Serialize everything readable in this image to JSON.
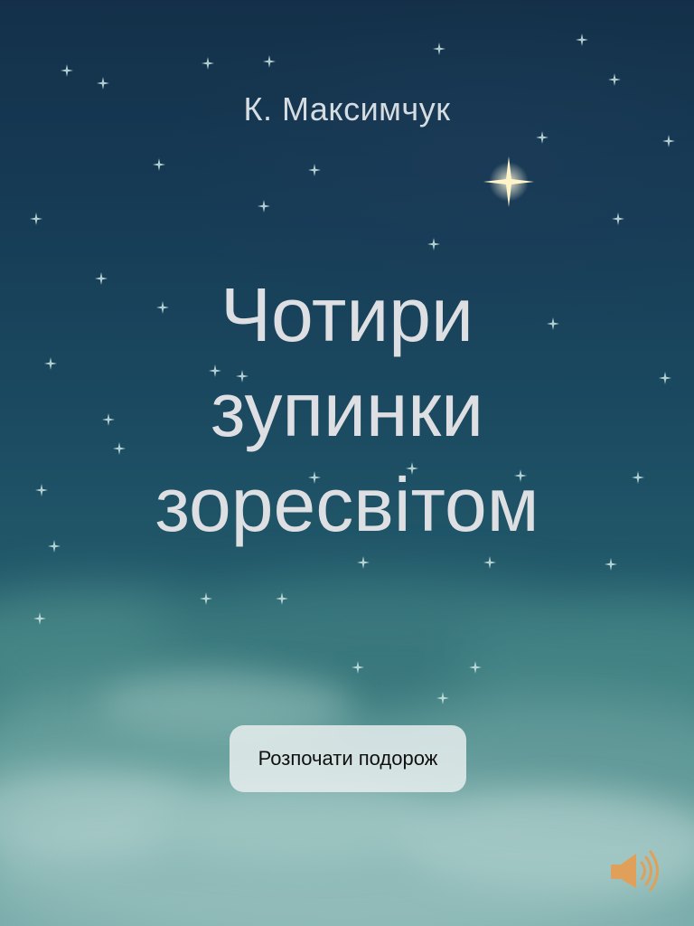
{
  "cover": {
    "author": "К. Максимчук",
    "title_lines": [
      "Чотири",
      "зупинки",
      "зоресвітом"
    ]
  },
  "actions": {
    "start_label": "Розпочати подорож",
    "sound_icon": "speaker-icon"
  },
  "colors": {
    "sky_top": "#143049",
    "sky_bottom": "#78abaa",
    "text": "#dedfe3",
    "button_bg": "#ebf0f0",
    "speaker": "#e0a05a"
  }
}
